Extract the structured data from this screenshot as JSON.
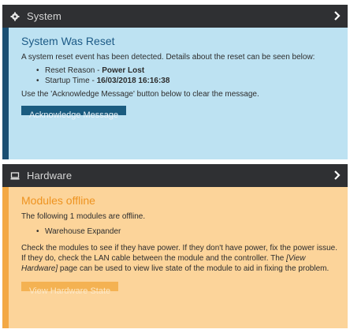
{
  "system_panel": {
    "header_title": "System",
    "header_icon": "gear-icon",
    "title": "System Was Reset",
    "description": "A system reset event has been detected. Details about the reset can be seen below:",
    "reset_reason_label": "Reset Reason - ",
    "reset_reason_value": "Power Lost",
    "startup_time_label": "Startup Time - ",
    "startup_time_value": "16/03/2018 16:16:38",
    "instruction": "Use the 'Acknowledge Message' button below to clear the message.",
    "button_label": "Acknowledge Message"
  },
  "hardware_panel": {
    "header_title": "Hardware",
    "header_icon": "monitor-icon",
    "title": "Modules offline",
    "intro": "The following 1 modules are offline.",
    "modules": [
      "Warehouse Expander"
    ],
    "help_text_before": "Check the modules to see if they have power. If they don't have power, fix the power issue. If they do, check the LAN cable between the module and the controller. The ",
    "help_link": "[View Hardware]",
    "help_text_after": " page can be used to view live state of the module to aid in fixing the problem.",
    "button_label": "View Hardware State"
  },
  "colors": {
    "header_bg": "#2f3033",
    "system_bg": "#bde2f2",
    "system_accent": "#1a4f73",
    "hardware_bg": "#fcd49a",
    "hardware_accent": "#f3a844"
  }
}
